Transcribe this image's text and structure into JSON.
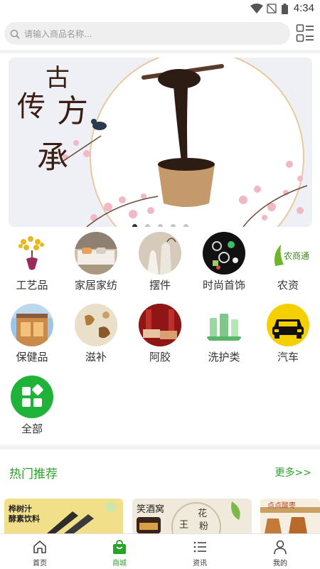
{
  "status_bar": {
    "time": "4:34"
  },
  "search": {
    "placeholder": "请输入商品名称..."
  },
  "banner": {
    "calligraphy": [
      "传",
      "古",
      "方",
      "承"
    ],
    "slide_count": 5,
    "active_slide": 0
  },
  "categories": [
    {
      "label": "工艺品"
    },
    {
      "label": "家居家纺"
    },
    {
      "label": "摆件"
    },
    {
      "label": "时尚首饰"
    },
    {
      "label": "农资",
      "logo_text": "农商通"
    },
    {
      "label": "保健品"
    },
    {
      "label": "滋补"
    },
    {
      "label": "阿胶"
    },
    {
      "label": "洗护类"
    },
    {
      "label": "汽车"
    },
    {
      "label": "全部"
    }
  ],
  "hot": {
    "title": "热门推荐",
    "more": "更多>>",
    "products": [
      {
        "caption_1": "桦树汁",
        "caption_2": "酵素饮料"
      },
      {
        "brand": "笑酒窝",
        "tag_1": "花",
        "tag_2": "粉",
        "tag_3": "王"
      },
      {
        "caption_1": "点点酸枣"
      }
    ]
  },
  "tabbar": [
    {
      "label": "首页",
      "icon": "home-icon"
    },
    {
      "label": "商城",
      "icon": "shopping-bag-icon"
    },
    {
      "label": "资讯",
      "icon": "list-icon"
    },
    {
      "label": "我的",
      "icon": "person-icon"
    }
  ],
  "colors": {
    "accent": "#2aa12a",
    "background": "#f3f3f3"
  }
}
